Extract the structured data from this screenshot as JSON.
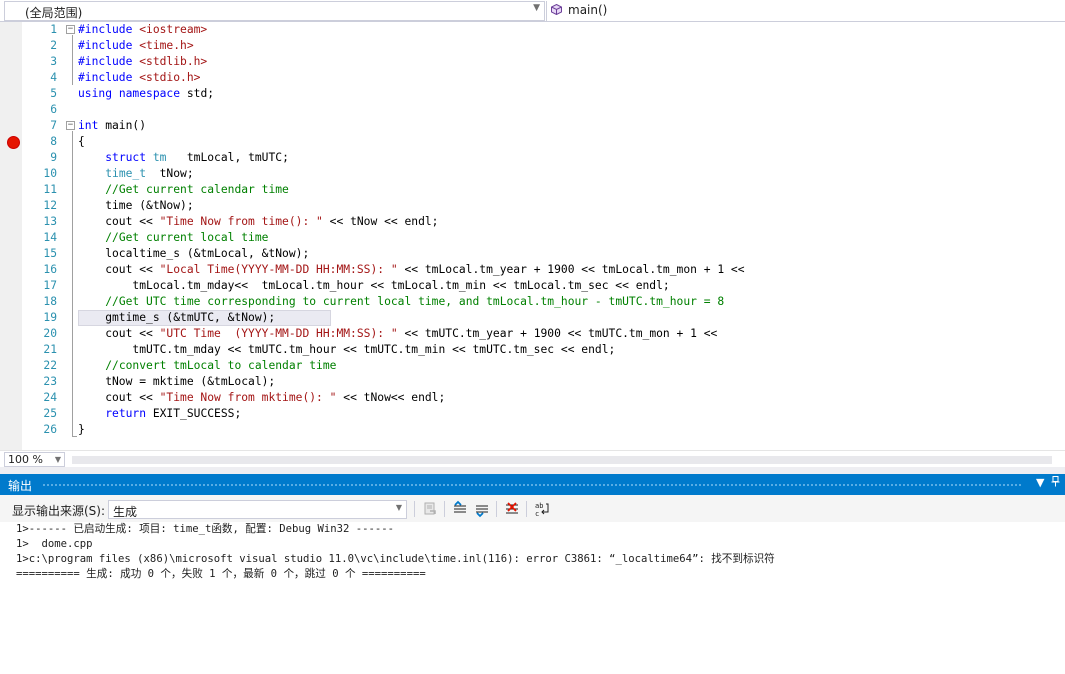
{
  "navbar": {
    "scope": "(全局范围)",
    "member": "main()"
  },
  "editor": {
    "current_line": 19,
    "breakpoint_line": 8,
    "lines": [
      {
        "n": "1",
        "tokens": [
          [
            "pp",
            "#include "
          ],
          [
            "str",
            "<iostream>"
          ]
        ]
      },
      {
        "n": "2",
        "tokens": [
          [
            "pp",
            "#include "
          ],
          [
            "str",
            "<time.h>"
          ]
        ]
      },
      {
        "n": "3",
        "tokens": [
          [
            "pp",
            "#include "
          ],
          [
            "str",
            "<stdlib.h>"
          ]
        ]
      },
      {
        "n": "4",
        "tokens": [
          [
            "pp",
            "#include "
          ],
          [
            "str",
            "<stdio.h>"
          ]
        ]
      },
      {
        "n": "5",
        "tokens": [
          [
            "kw",
            "using"
          ],
          [
            "plain",
            " "
          ],
          [
            "kw",
            "namespace"
          ],
          [
            "plain",
            " std;"
          ]
        ]
      },
      {
        "n": "6",
        "tokens": []
      },
      {
        "n": "7",
        "tokens": [
          [
            "kw",
            "int"
          ],
          [
            "plain",
            " main()"
          ]
        ]
      },
      {
        "n": "8",
        "tokens": [
          [
            "plain",
            "{"
          ]
        ]
      },
      {
        "n": "9",
        "tokens": [
          [
            "plain",
            "    "
          ],
          [
            "kw",
            "struct"
          ],
          [
            "plain",
            " "
          ],
          [
            "type",
            "tm"
          ],
          [
            "plain",
            "   tmLocal, tmUTC;"
          ]
        ]
      },
      {
        "n": "10",
        "tokens": [
          [
            "plain",
            "    "
          ],
          [
            "type",
            "time_t"
          ],
          [
            "plain",
            "  tNow;"
          ]
        ]
      },
      {
        "n": "11",
        "tokens": [
          [
            "plain",
            "    "
          ],
          [
            "cmt",
            "//Get current calendar time"
          ]
        ]
      },
      {
        "n": "12",
        "tokens": [
          [
            "plain",
            "    time (&tNow);"
          ]
        ]
      },
      {
        "n": "13",
        "tokens": [
          [
            "plain",
            "    cout << "
          ],
          [
            "str",
            "\"Time Now from time(): \""
          ],
          [
            "plain",
            " << tNow << endl;"
          ]
        ]
      },
      {
        "n": "14",
        "tokens": [
          [
            "plain",
            "    "
          ],
          [
            "cmt",
            "//Get current local time"
          ]
        ]
      },
      {
        "n": "15",
        "tokens": [
          [
            "plain",
            "    localtime_s (&tmLocal, &tNow);"
          ]
        ]
      },
      {
        "n": "16",
        "tokens": [
          [
            "plain",
            "    cout << "
          ],
          [
            "str",
            "\"Local Time(YYYY-MM-DD HH:MM:SS): \""
          ],
          [
            "plain",
            " << tmLocal.tm_year + 1900 << tmLocal.tm_mon + 1 <<"
          ]
        ]
      },
      {
        "n": "17",
        "tokens": [
          [
            "plain",
            "        tmLocal.tm_mday<<  tmLocal.tm_hour << tmLocal.tm_min << tmLocal.tm_sec << endl;"
          ]
        ]
      },
      {
        "n": "18",
        "tokens": [
          [
            "plain",
            "    "
          ],
          [
            "cmt",
            "//Get UTC time corresponding to current local time, and tmLocal.tm_hour - tmUTC.tm_hour = 8"
          ]
        ]
      },
      {
        "n": "19",
        "tokens": [
          [
            "plain",
            "    gmtime_s (&tmUTC, &tNow);"
          ]
        ]
      },
      {
        "n": "20",
        "tokens": [
          [
            "plain",
            "    cout << "
          ],
          [
            "str",
            "\"UTC Time  (YYYY-MM-DD HH:MM:SS): \""
          ],
          [
            "plain",
            " << tmUTC.tm_year + 1900 << tmUTC.tm_mon + 1 <<"
          ]
        ]
      },
      {
        "n": "21",
        "tokens": [
          [
            "plain",
            "        tmUTC.tm_mday << tmUTC.tm_hour << tmUTC.tm_min << tmUTC.tm_sec << endl;"
          ]
        ]
      },
      {
        "n": "22",
        "tokens": [
          [
            "plain",
            "    "
          ],
          [
            "cmt",
            "//convert tmLocal to calendar time"
          ]
        ]
      },
      {
        "n": "23",
        "tokens": [
          [
            "plain",
            "    tNow = mktime (&tmLocal);"
          ]
        ]
      },
      {
        "n": "24",
        "tokens": [
          [
            "plain",
            "    cout << "
          ],
          [
            "str",
            "\"Time Now from mktime(): \""
          ],
          [
            "plain",
            " << tNow<< endl;"
          ]
        ]
      },
      {
        "n": "25",
        "tokens": [
          [
            "plain",
            "    "
          ],
          [
            "kw",
            "return"
          ],
          [
            "plain",
            " EXIT_SUCCESS;"
          ]
        ]
      },
      {
        "n": "26",
        "tokens": [
          [
            "plain",
            "}"
          ]
        ]
      }
    ]
  },
  "zoom": {
    "value": "100 %"
  },
  "output": {
    "title": "输出",
    "source_label": "显示输出来源(S):",
    "source_value": "生成",
    "lines": [
      "1>------ 已启动生成: 项目: time_t函数, 配置: Debug Win32 ------",
      "1>  dome.cpp",
      "1>c:\\program files (x86)\\microsoft visual studio 11.0\\vc\\include\\time.inl(116): error C3861: “_localtime64”: 找不到标识符",
      "========== 生成: 成功 0 个，失败 1 个，最新 0 个，跳过 0 个 =========="
    ]
  },
  "icons": {
    "member": "cube-icon",
    "pin": "pin-icon",
    "dropdown": "chevron-down-icon"
  },
  "colors": {
    "accent": "#007acc",
    "keyword": "#0000ff",
    "string": "#a31515",
    "comment": "#008000",
    "type": "#2b91af",
    "breakpoint": "#e51400"
  }
}
